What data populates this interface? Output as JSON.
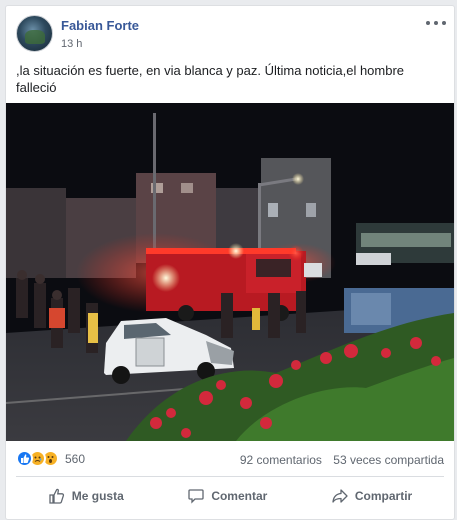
{
  "post": {
    "author": "Fabian Forte",
    "time": "13 h",
    "text": ",la situación es fuerte, en via blanca y paz. Última noticia,el hombre falleció"
  },
  "reactions": {
    "count": "560",
    "icons": [
      "like-icon",
      "sad-icon",
      "wow-icon"
    ],
    "comments": "92 comentarios",
    "shares": "53 veces compartida"
  },
  "actions": {
    "like": "Me gusta",
    "comment": "Comentar",
    "share": "Compartir"
  },
  "colors": {
    "author": "#385898",
    "like": "#1877f2",
    "emoji": "#f7b125",
    "muted": "#606770"
  }
}
